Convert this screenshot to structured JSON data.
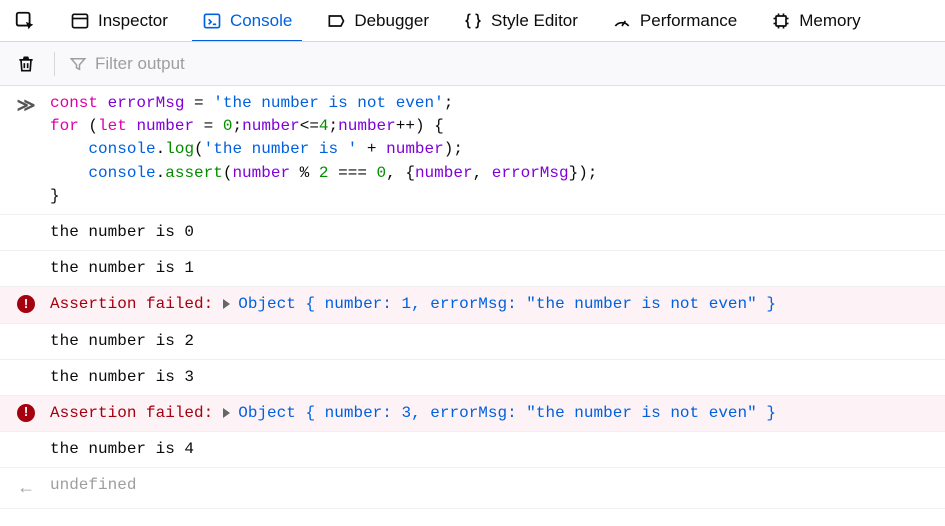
{
  "tabs": {
    "inspector": "Inspector",
    "console": "Console",
    "debugger": "Debugger",
    "styleeditor": "Style Editor",
    "performance": "Performance",
    "memory": "Memory"
  },
  "filter": {
    "placeholder": "Filter output"
  },
  "code": {
    "l1a": "const",
    "l1b": "errorMsg",
    "l1c": "=",
    "l1d": "'the number is not even'",
    "l1e": ";",
    "l2a": "for",
    "l2b": "(",
    "l2c": "let",
    "l2d": "number",
    "l2e": "=",
    "l2f": "0",
    "l2g": ";",
    "l2h": "number",
    "l2i": "<=",
    "l2j": "4",
    "l2k": ";",
    "l2l": "number",
    "l2m": "++",
    "l2n": ") {",
    "l3a": "    ",
    "l3b": "console",
    "l3c": ".",
    "l3d": "log",
    "l3e": "(",
    "l3f": "'the number is '",
    "l3g": "+",
    "l3h": "number",
    "l3i": ");",
    "l4a": "    ",
    "l4b": "console",
    "l4c": ".",
    "l4d": "assert",
    "l4e": "(",
    "l4f": "number",
    "l4g": "%",
    "l4h": "2",
    "l4i": "===",
    "l4j": "0",
    "l4k": ", {",
    "l4l": "number",
    "l4m": ",",
    "l4n": "errorMsg",
    "l4o": "});",
    "l5": "}"
  },
  "logs": {
    "n0": "the number is 0",
    "n1": "the number is 1",
    "n2": "the number is 2",
    "n3": "the number is 3",
    "n4": "the number is 4"
  },
  "assert": {
    "label": "Assertion failed:",
    "obj_open": "Object { ",
    "k1": "number",
    "colon": ": ",
    "v1a": "1",
    "v1b": "3",
    "sep": ", ",
    "k2": "errorMsg",
    "v2": "\"the number is not even\"",
    "obj_close": " }"
  },
  "return": {
    "value": "undefined"
  },
  "prompt": {
    "in": "≫",
    "out": "←"
  }
}
